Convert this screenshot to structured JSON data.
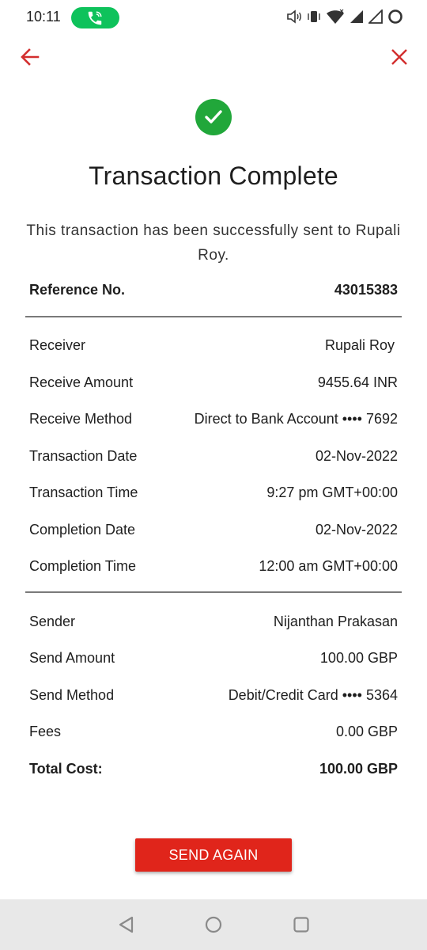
{
  "status_bar": {
    "time": "10:11",
    "icons": [
      "call-active-icon",
      "volume-icon",
      "vibrate-icon",
      "wifi-icon",
      "signal-icon",
      "signal-icon",
      "battery-ring-icon"
    ]
  },
  "nav": {
    "back_icon": "arrow-left-icon",
    "close_icon": "close-icon",
    "accent_color": "#d32f2f"
  },
  "status": {
    "icon": "check-circle-icon",
    "color": "#21a73a",
    "title": "Transaction Complete",
    "message": "This transaction has been successfully sent to Rupali Roy."
  },
  "reference": {
    "label": "Reference No.",
    "value": "43015383"
  },
  "receiver_section": [
    {
      "label": "Receiver",
      "value": "Rupali  Roy"
    },
    {
      "label": "Receive Amount",
      "value": "9455.64 INR"
    },
    {
      "label": "Receive Method",
      "value": "Direct to Bank Account •••• 7692"
    },
    {
      "label": "Transaction Date",
      "value": "02-Nov-2022"
    },
    {
      "label": "Transaction Time",
      "value": "9:27 pm GMT+00:00"
    },
    {
      "label": "Completion Date",
      "value": "02-Nov-2022"
    },
    {
      "label": "Completion Time",
      "value": "12:00 am GMT+00:00"
    }
  ],
  "sender_section": [
    {
      "label": "Sender",
      "value": "Nijanthan Prakasan"
    },
    {
      "label": "Send Amount",
      "value": "100.00 GBP"
    },
    {
      "label": "Send Method",
      "value": "Debit/Credit Card •••• 5364"
    },
    {
      "label": "Fees",
      "value": "0.00 GBP"
    }
  ],
  "total": {
    "label": "Total Cost:",
    "value": "100.00 GBP"
  },
  "actions": {
    "send_again_label": "SEND AGAIN",
    "button_color": "#e0251b"
  },
  "system_nav": {
    "icons": [
      "back-triangle-icon",
      "home-circle-icon",
      "recents-square-icon"
    ]
  }
}
